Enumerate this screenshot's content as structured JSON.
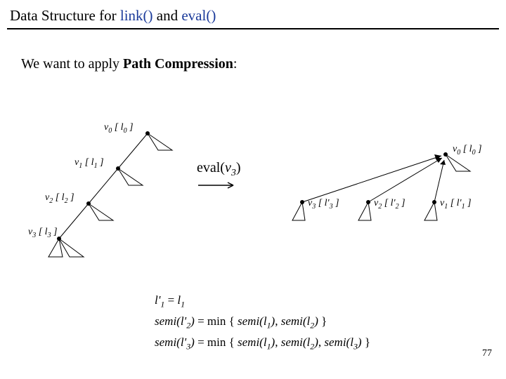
{
  "title": {
    "pre": "Data Structure for ",
    "fn1": "link()",
    "mid": " and ",
    "fn2": "eval()"
  },
  "intro": {
    "pre": "We want to apply ",
    "bold": "Path Compression",
    "post": ":"
  },
  "eval_label": {
    "fn": "eval(",
    "var": "v",
    "sub": "3",
    "close": ")"
  },
  "nodes_left": {
    "v0": {
      "v": "v",
      "vs": "0",
      "l": "l",
      "ls": "0"
    },
    "v1": {
      "v": "v",
      "vs": "1",
      "l": "l",
      "ls": "1"
    },
    "v2": {
      "v": "v",
      "vs": "2",
      "l": "l",
      "ls": "2"
    },
    "v3": {
      "v": "v",
      "vs": "3",
      "l": "l",
      "ls": "3"
    }
  },
  "nodes_right": {
    "v0": {
      "v": "v",
      "vs": "0",
      "l": "l",
      "ls": "0"
    },
    "v1": {
      "v": "v",
      "vs": "1",
      "l": "l'",
      "ls": "1"
    },
    "v2": {
      "v": "v",
      "vs": "2",
      "l": "l'",
      "ls": "2"
    },
    "v3": {
      "v": "v",
      "vs": "3",
      "l": "l'",
      "ls": "3"
    }
  },
  "formulas": {
    "f1": {
      "lhs_l": "l'",
      "lhs_s": "1",
      "eq": " = ",
      "rhs_l": "l",
      "rhs_s": "1"
    },
    "f2": {
      "lhs_fn": "semi(",
      "lhs_l": "l'",
      "lhs_s": "2",
      "lhs_close": ")",
      "eq": " = min { ",
      "t1_fn": "semi(",
      "t1_l": "l",
      "t1_s": "1",
      "t1_close": ")",
      "sep1": ", ",
      "t2_fn": "semi(",
      "t2_l": "l",
      "t2_s": "2",
      "t2_close": ")",
      "end": " }"
    },
    "f3": {
      "lhs_fn": "semi(",
      "lhs_l": "l'",
      "lhs_s": "3",
      "lhs_close": ")",
      "eq": " = min { ",
      "t1_fn": "semi(",
      "t1_l": "l",
      "t1_s": "1",
      "t1_close": ")",
      "sep1": ", ",
      "t2_fn": "semi(",
      "t2_l": "l",
      "t2_s": "2",
      "t2_close": ")",
      "sep2": ", ",
      "t3_fn": "semi(",
      "t3_l": "l",
      "t3_s": "3",
      "t3_close": ")",
      "end": " }"
    }
  },
  "page_number": "77",
  "chart_data": {
    "type": "diagram",
    "description": "Path compression in a link/eval forest",
    "before": {
      "structure": "chain",
      "nodes": [
        {
          "id": "v0",
          "label": "l0",
          "parent": null
        },
        {
          "id": "v1",
          "label": "l1",
          "parent": "v0"
        },
        {
          "id": "v2",
          "label": "l2",
          "parent": "v1"
        },
        {
          "id": "v3",
          "label": "l3",
          "parent": "v2"
        }
      ]
    },
    "operation": "eval(v3)",
    "after": {
      "structure": "star",
      "root": "v0",
      "nodes": [
        {
          "id": "v0",
          "label": "l0",
          "parent": null
        },
        {
          "id": "v1",
          "label": "l'1",
          "parent": "v0"
        },
        {
          "id": "v2",
          "label": "l'2",
          "parent": "v0"
        },
        {
          "id": "v3",
          "label": "l'3",
          "parent": "v0"
        }
      ]
    },
    "label_definitions": [
      "l'1 = l1",
      "semi(l'2) = min{ semi(l1), semi(l2) }",
      "semi(l'3) = min{ semi(l1), semi(l2), semi(l3) }"
    ]
  }
}
